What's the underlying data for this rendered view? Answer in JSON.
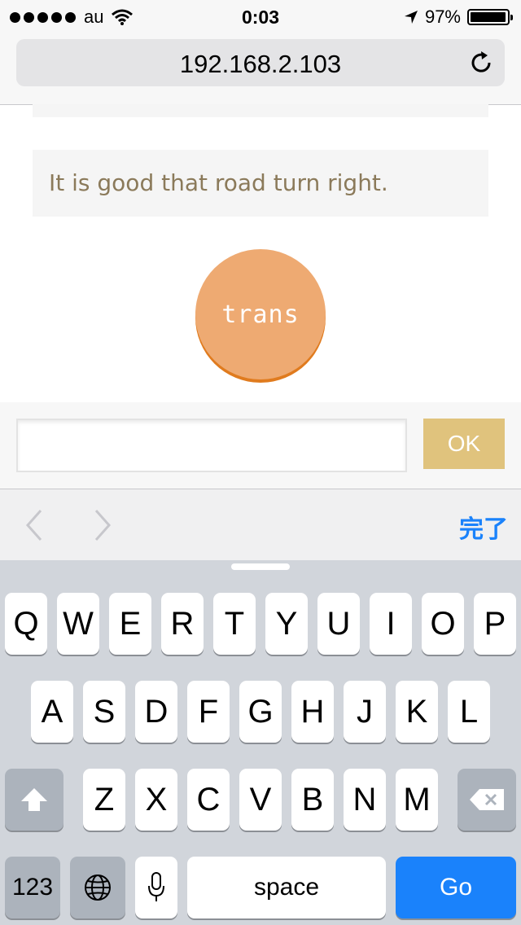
{
  "status_bar": {
    "carrier": "au",
    "time": "0:03",
    "battery_text": "97%",
    "battery_level": 0.97
  },
  "browser": {
    "url": "192.168.2.103"
  },
  "content": {
    "message": "It is good that road turn right.",
    "trans_button": "trans"
  },
  "input_bar": {
    "value": "",
    "ok_button": "OK"
  },
  "accessory": {
    "done": "完了"
  },
  "keyboard": {
    "row1": [
      "Q",
      "W",
      "E",
      "R",
      "T",
      "Y",
      "U",
      "I",
      "O",
      "P"
    ],
    "row2": [
      "A",
      "S",
      "D",
      "F",
      "G",
      "H",
      "J",
      "K",
      "L"
    ],
    "row3": [
      "Z",
      "X",
      "C",
      "V",
      "B",
      "N",
      "M"
    ],
    "numbers_key": "123",
    "space_key": "space",
    "go_key": "Go"
  },
  "colors": {
    "accent_blue": "#1a82fb",
    "trans_button": "#eeaa72",
    "ok_button": "#e0c37d",
    "message_text": "#8b7a5a"
  },
  "icons": [
    "wifi-icon",
    "location-arrow-icon",
    "reload-icon",
    "chevron-left-icon",
    "chevron-right-icon",
    "shift-icon",
    "globe-icon",
    "microphone-icon",
    "backspace-icon"
  ]
}
